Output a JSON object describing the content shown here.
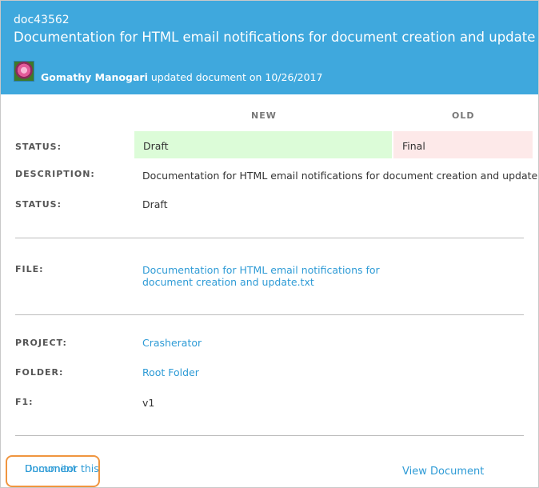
{
  "header": {
    "doc_id": "doc43562",
    "title": "Documentation for HTML email notifications for document creation and update",
    "author": "Gomathy Manogari",
    "action_text": "updated document on 10/26/2017"
  },
  "columns": {
    "new": "NEW",
    "old": "OLD"
  },
  "changes": {
    "status_label": "STATUS:",
    "status_new": "Draft",
    "status_old": "Final"
  },
  "details": {
    "description_label": "DESCRIPTION:",
    "description_value": "Documentation for HTML email notifications for document creation and update",
    "status_label": "STATUS:",
    "status_value": "Draft"
  },
  "file": {
    "label": "FILE:",
    "line1": "Documentation for HTML email notifications for",
    "line2": "document creation and update.txt"
  },
  "meta": {
    "project_label": "PROJECT:",
    "project_value": "Crasherator",
    "folder_label": "FOLDER:",
    "folder_value": "Root Folder",
    "f1_label": "F1:",
    "f1_value": "v1"
  },
  "footer": {
    "unmonitor_line1": "Unmonitor this",
    "unmonitor_line2": "Document",
    "view_document": "View Document"
  },
  "colors": {
    "header_bg": "#3fa8dd",
    "link": "#2e9bd6",
    "new_bg": "#dcfcd8",
    "old_bg": "#fde9e9",
    "highlight_border": "#f0953f"
  }
}
